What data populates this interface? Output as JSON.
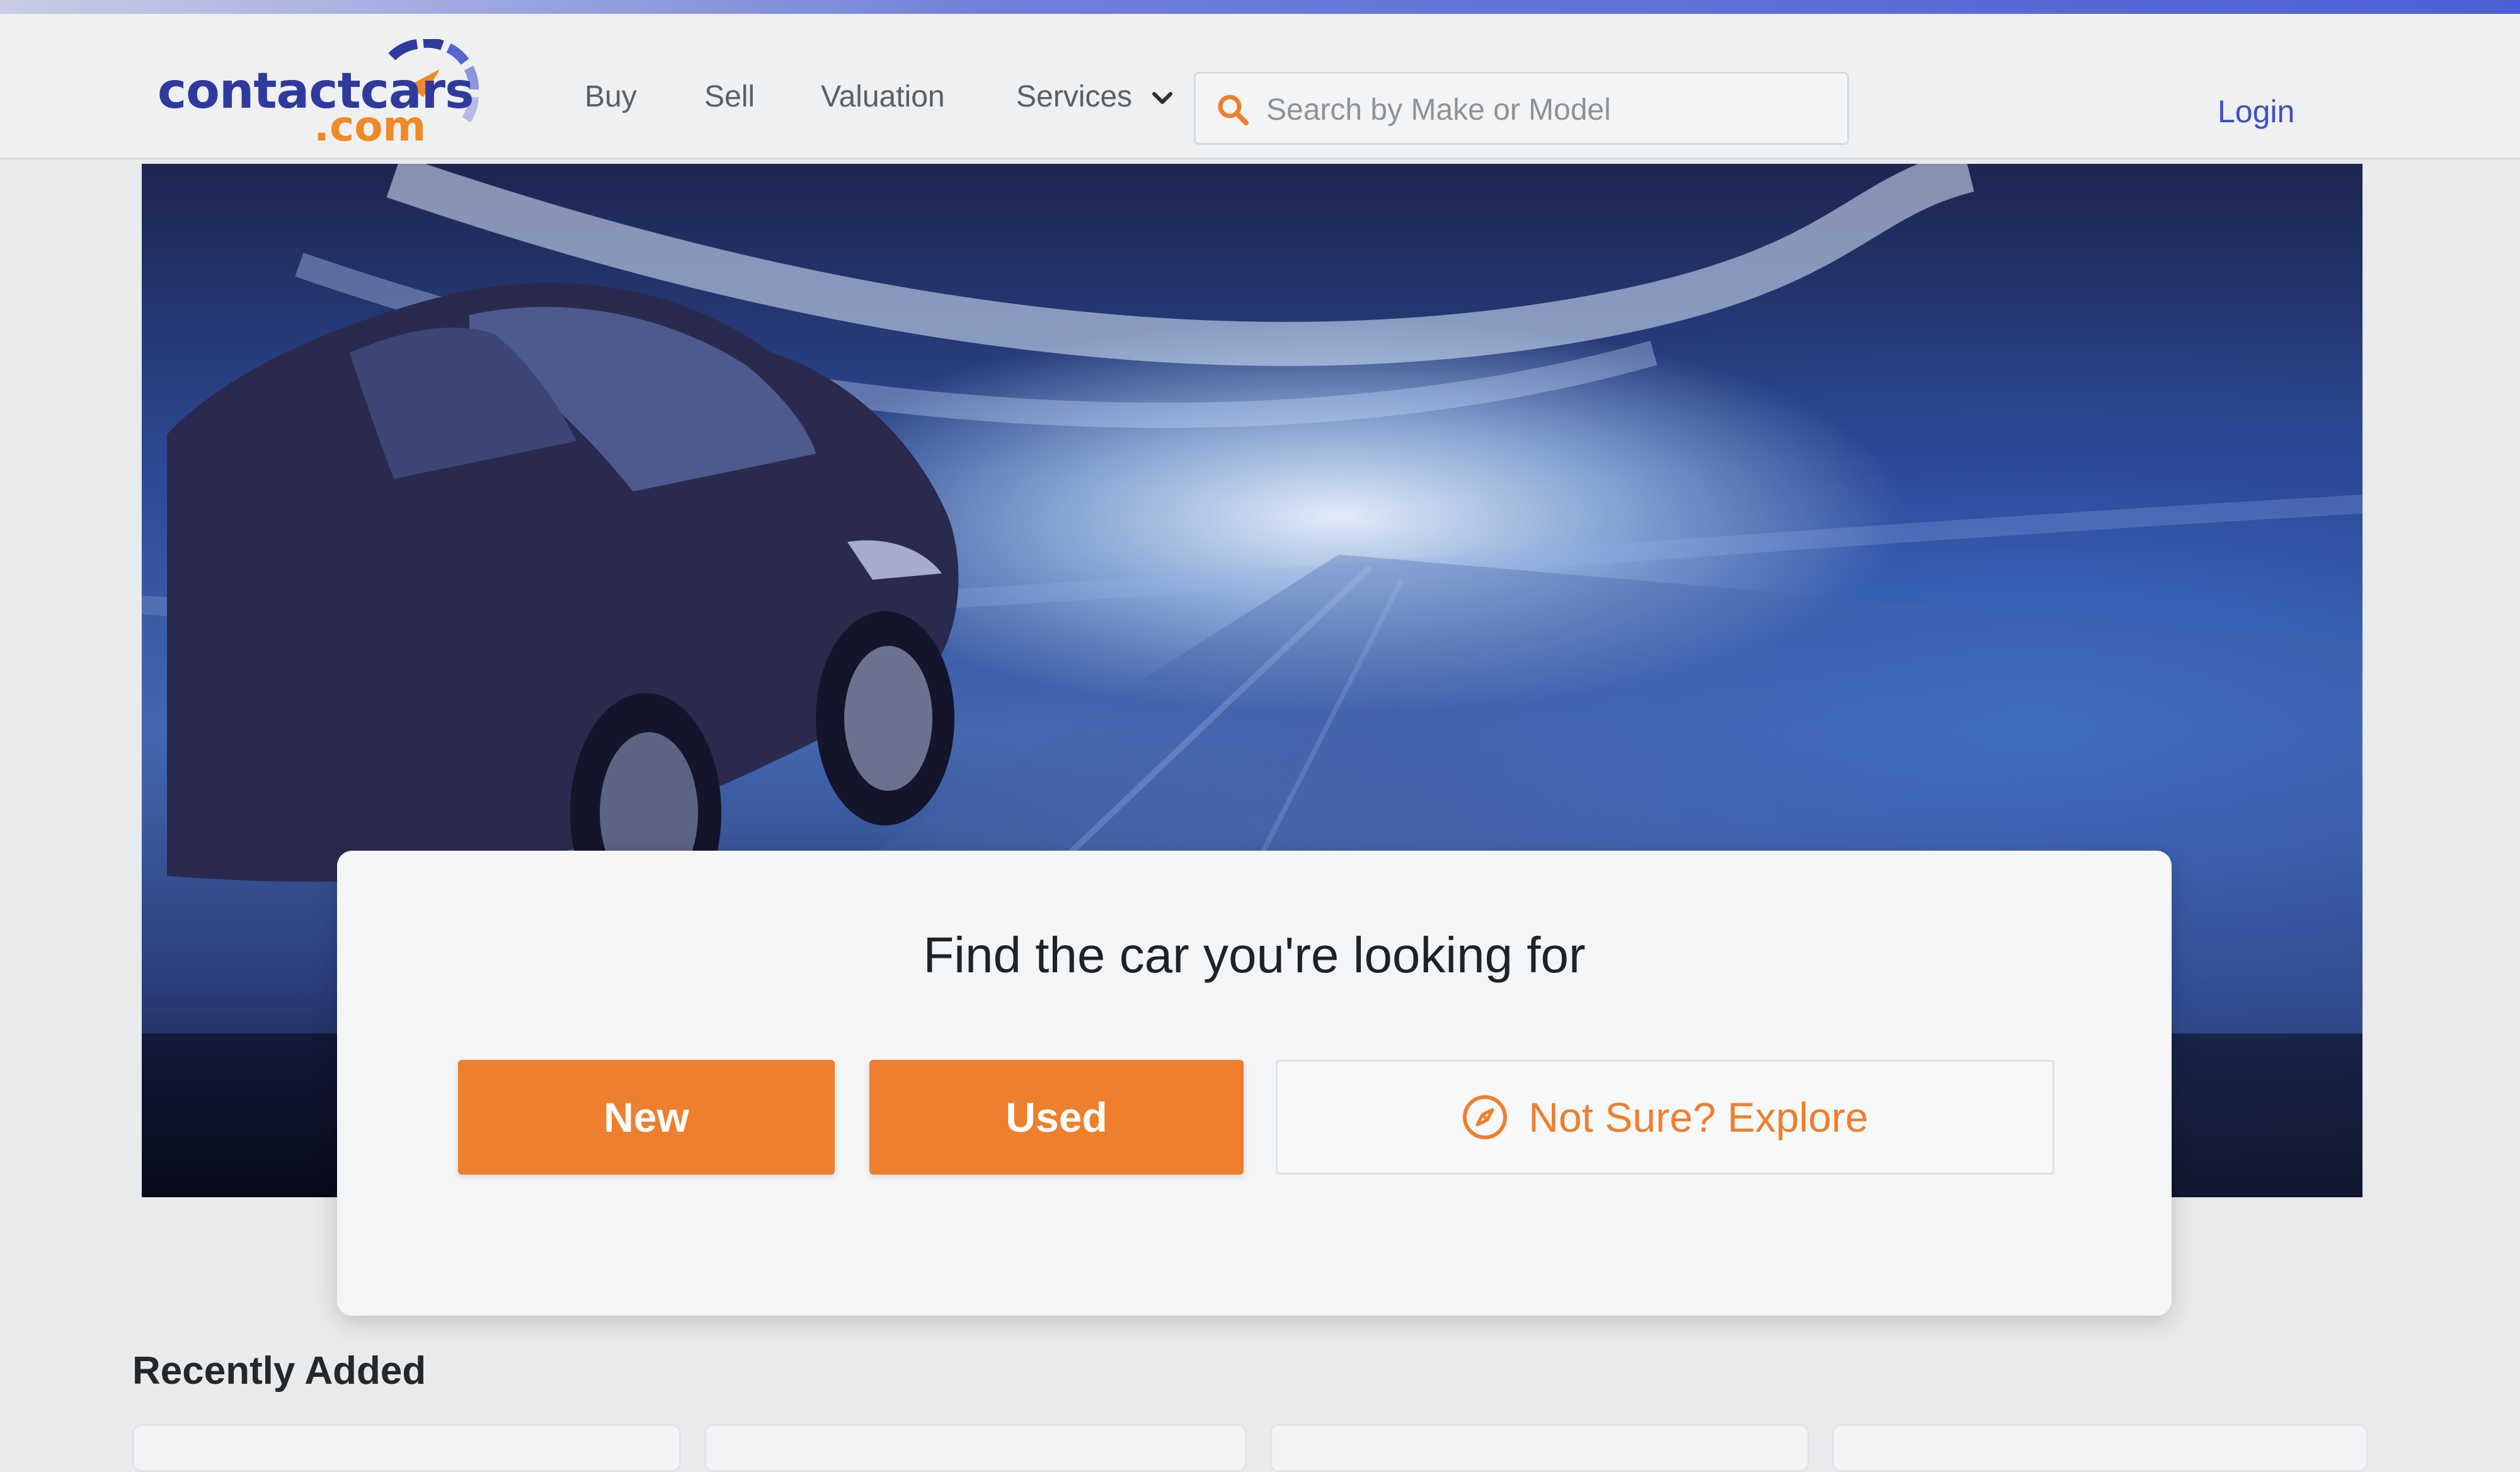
{
  "header": {
    "logo": {
      "main": "contactcars",
      "sub": ".com"
    },
    "nav": {
      "buy": "Buy",
      "sell": "Sell",
      "valuation": "Valuation",
      "services": "Services"
    },
    "search": {
      "placeholder": "Search by Make or Model",
      "value": ""
    },
    "login": "Login"
  },
  "hero": {
    "card": {
      "title": "Find the car you're looking for",
      "new_label": "New",
      "used_label": "Used",
      "explore_label": "Not Sure? Explore"
    }
  },
  "recently_added": {
    "title": "Recently Added"
  },
  "colors": {
    "brand_blue": "#2f3a9e",
    "accent_orange": "#ee7f2d",
    "link_blue": "#3e4ec6"
  },
  "icons": [
    "search-icon",
    "chevron-down-icon",
    "compass-icon",
    "speedometer-logo-icon"
  ]
}
